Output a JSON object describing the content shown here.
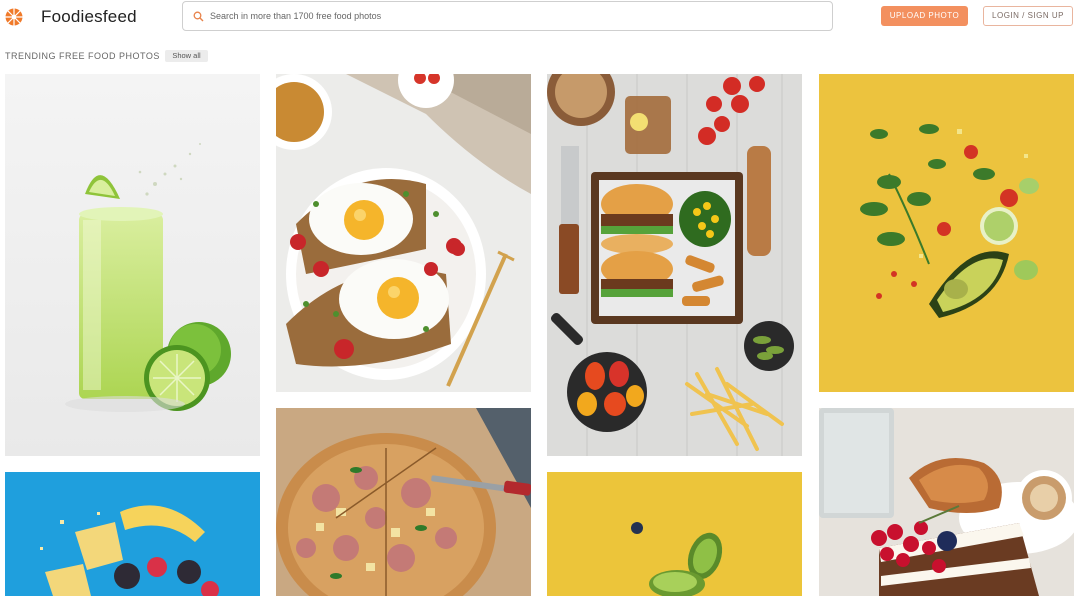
{
  "header": {
    "brand": "Foodiesfeed",
    "search_placeholder": "Search in more than 1700 free food photos",
    "upload_label": "UPLOAD PHOTO",
    "login_label": "LOGIN / SIGN UP"
  },
  "section": {
    "title": "TRENDING FREE FOOD PHOTOS",
    "show_all_label": "Show all"
  },
  "photos": [
    {
      "subject": "lime-juice-splash"
    },
    {
      "subject": "avocado-toast-fried-eggs"
    },
    {
      "subject": "burger-and-fries-tray"
    },
    {
      "subject": "flying-avocado-vegetables"
    },
    {
      "subject": "flying-fruit-blue"
    },
    {
      "subject": "ham-pineapple-pizza"
    },
    {
      "subject": "flying-kiwi-yellow"
    },
    {
      "subject": "cake-and-coffee"
    }
  ],
  "colors": {
    "accent": "#f3905f",
    "login_border": "#e9b59e"
  }
}
